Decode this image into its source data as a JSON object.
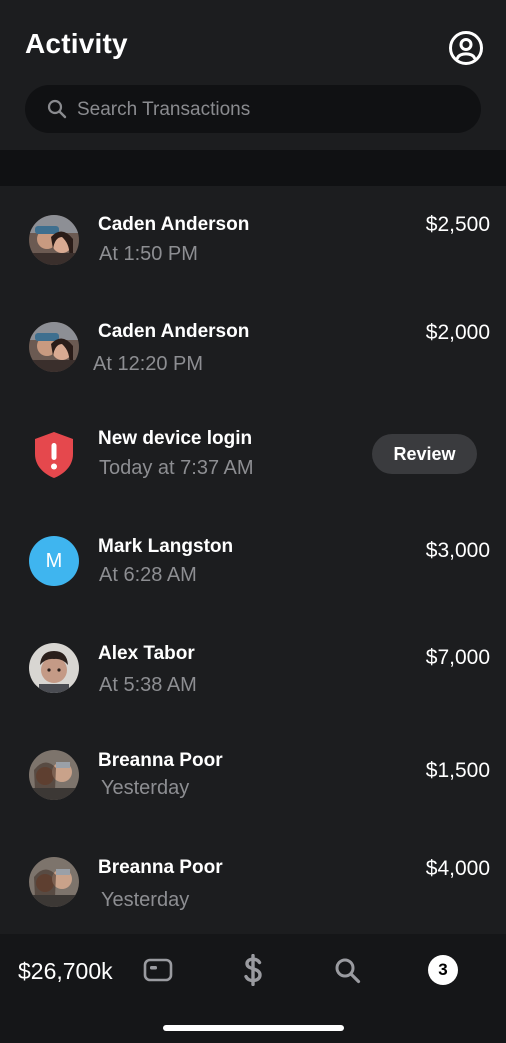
{
  "header": {
    "title": "Activity",
    "profile_icon": "profile-circle-icon"
  },
  "search": {
    "placeholder": "Search Transactions",
    "icon": "search-icon"
  },
  "activity": [
    {
      "name": "Caden Anderson",
      "sub": "At 1:50 PM",
      "amount": "$2,500",
      "avatar": "photo"
    },
    {
      "name": "Caden Anderson",
      "sub": "At 12:20 PM",
      "amount": "$2,000",
      "avatar": "photo"
    },
    {
      "name": "New device login",
      "sub": "Today at 7:37 AM",
      "action": "Review",
      "avatar": "alert-shield-icon"
    },
    {
      "name": "Mark Langston",
      "sub": "At 6:28 AM",
      "amount": "$3,000",
      "avatar_letter": "M"
    },
    {
      "name": "Alex Tabor",
      "sub": "At 5:38 AM",
      "amount": "$7,000",
      "avatar": "photo"
    },
    {
      "name": "Breanna Poor",
      "sub": "Yesterday",
      "amount": "$1,500",
      "avatar": "photo"
    },
    {
      "name": "Breanna Poor",
      "sub": "Yesterday",
      "amount": "$4,000",
      "avatar": "photo"
    }
  ],
  "bottom_nav": {
    "balance": "$26,700k",
    "items": [
      "card-icon",
      "dollar-icon",
      "search-icon",
      "activity-badge"
    ],
    "badge_count": "3"
  },
  "colors": {
    "background": "#1c1d1f",
    "accent_alert": "#e5484d",
    "avatar_letter_bg": "#3fb5ef"
  }
}
